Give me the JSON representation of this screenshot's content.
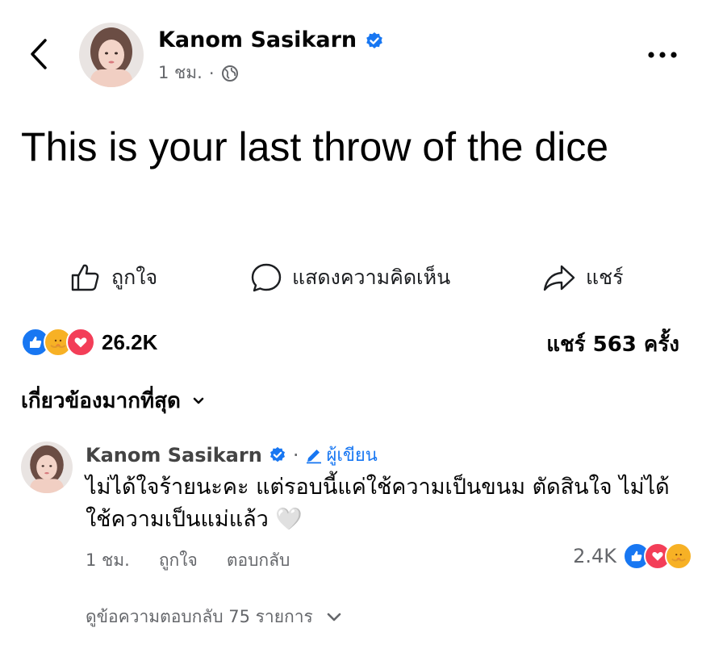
{
  "post": {
    "author": "Kanom Sasikarn",
    "time": "1 ชม.",
    "separator": "·",
    "text": "This is your last throw of the dice"
  },
  "actions": {
    "like": "ถูกใจ",
    "comment": "แสดงความคิดเห็น",
    "share": "แชร์"
  },
  "stats": {
    "reaction_count": "26.2K",
    "shares": "แชร์ 563 ครั้ง"
  },
  "sort": {
    "label": "เกี่ยวข้องมากที่สุด"
  },
  "comment": {
    "author": "Kanom Sasikarn",
    "separator": "·",
    "badge": "ผู้เขียน",
    "text": "ไม่ได้ใจร้ายนะคะ แต่รอบนี้แค่ใช้ความเป็นขนม ตัดสินใจ ไม่ได้ใช้ความเป็นแม่แล้ว 🤍",
    "time": "1 ชม.",
    "like": "ถูกใจ",
    "reply": "ตอบกลับ",
    "reaction_count": "2.4K"
  },
  "replies": {
    "label": "ดูข้อความตอบกลับ 75 รายการ"
  },
  "icons": {
    "back": "chevron-left-icon",
    "more": "more-horizontal-icon",
    "verified": "verified-badge-icon",
    "globe": "globe-icon",
    "like": "thumbs-up-icon",
    "comment": "comment-bubble-icon",
    "share": "share-arrow-icon",
    "edit": "pencil-icon",
    "sort": "chevron-down-icon"
  },
  "colors": {
    "brand_blue": "#1877f2",
    "love_red": "#f33e58",
    "care_yellow": "#f7b125",
    "secondary_text": "#65676b"
  }
}
